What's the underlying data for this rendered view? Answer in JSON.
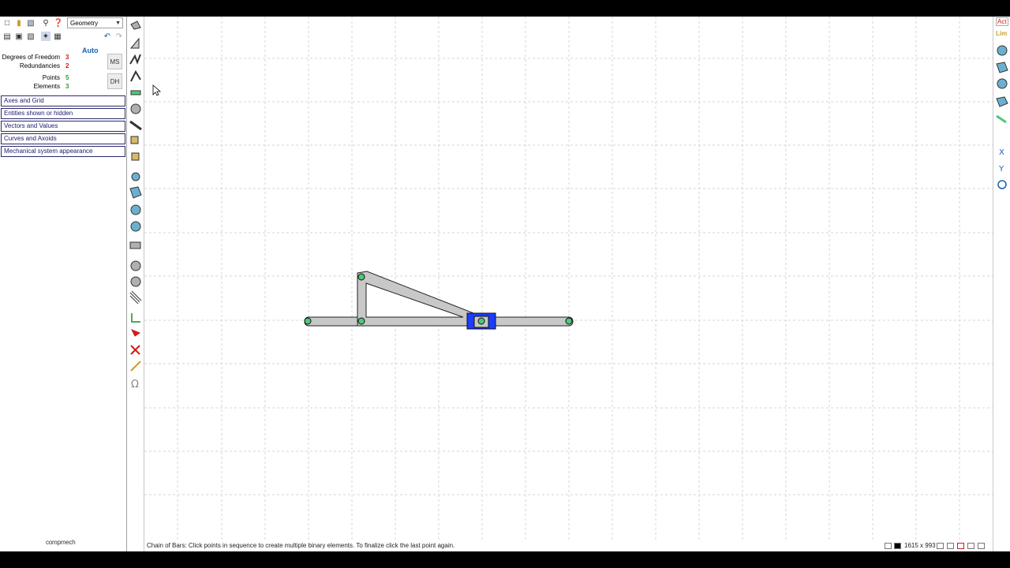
{
  "toolbar": {
    "mode_select_value": "Geometry",
    "auto_label": "Auto"
  },
  "stats": [
    {
      "label": "Degrees of Freedom",
      "value": "3",
      "color": "#d01c1c"
    },
    {
      "label": "Redundancies",
      "value": "2",
      "color": "#d01c1c"
    },
    {
      "label": "Points",
      "value": "5",
      "color": "#2a9d2a"
    },
    {
      "label": "Elements",
      "value": "3",
      "color": "#2a9d2a"
    }
  ],
  "side_buttons": {
    "ms": "MS",
    "dh": "DH"
  },
  "menus": [
    "Axes and Grid",
    "Entities shown or hidden",
    "Vectors and Values",
    "Curves and Axoids",
    "Mechanical system appearance"
  ],
  "logo_text": "compmech",
  "right_panel": {
    "act": "Act",
    "lim": "Lim",
    "x": "X",
    "y": "Y"
  },
  "status": {
    "message": "Chain of Bars: Click points in sequence to create multiple binary elements. To finalize click the last point again.",
    "dims": "1615 x 993"
  },
  "colors": {
    "bar_fill": "#c8c8c8",
    "joint_fill": "#4fc87a",
    "slider_fill": "#1c3cff"
  }
}
